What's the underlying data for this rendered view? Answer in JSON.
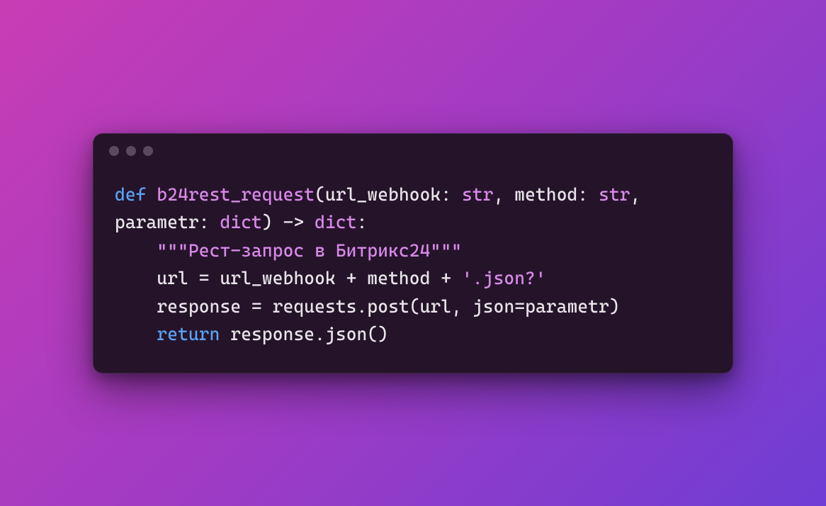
{
  "code": {
    "kw_def": "def",
    "fn_name": "b24rest_request",
    "paren_open": "(",
    "param1_name": "url_webhook",
    "colon1": ": ",
    "param1_type": "str",
    "comma1": ", ",
    "param2_name": "method",
    "colon2": ": ",
    "param2_type": "str",
    "comma2": ", ",
    "param3_name": "parametr",
    "colon3": ": ",
    "param3_type": "dict",
    "paren_close": ")",
    "arrow": " -> ",
    "ret_type": "dict",
    "sig_colon": ":",
    "docstring": "\"\"\"Рест-запрос в Битрикс24\"\"\"",
    "l3_var": "url",
    "l3_eq": " = ",
    "l3_a": "url_webhook",
    "l3_plus1": " + ",
    "l3_b": "method",
    "l3_plus2": " + ",
    "l3_str": "'.json?'",
    "l4_var": "response",
    "l4_eq": " = ",
    "l4_mod": "requests",
    "l4_dot": ".",
    "l4_call": "post",
    "l4_popen": "(",
    "l4_arg1": "url",
    "l4_comma": ", ",
    "l4_kwarg": "json",
    "l4_eq2": "=",
    "l4_arg2": "parametr",
    "l4_pclose": ")",
    "l5_kw": "return",
    "l5_sp": " ",
    "l5_expr": "response",
    "l5_dot": ".",
    "l5_call": "json",
    "l5_parens": "()"
  }
}
